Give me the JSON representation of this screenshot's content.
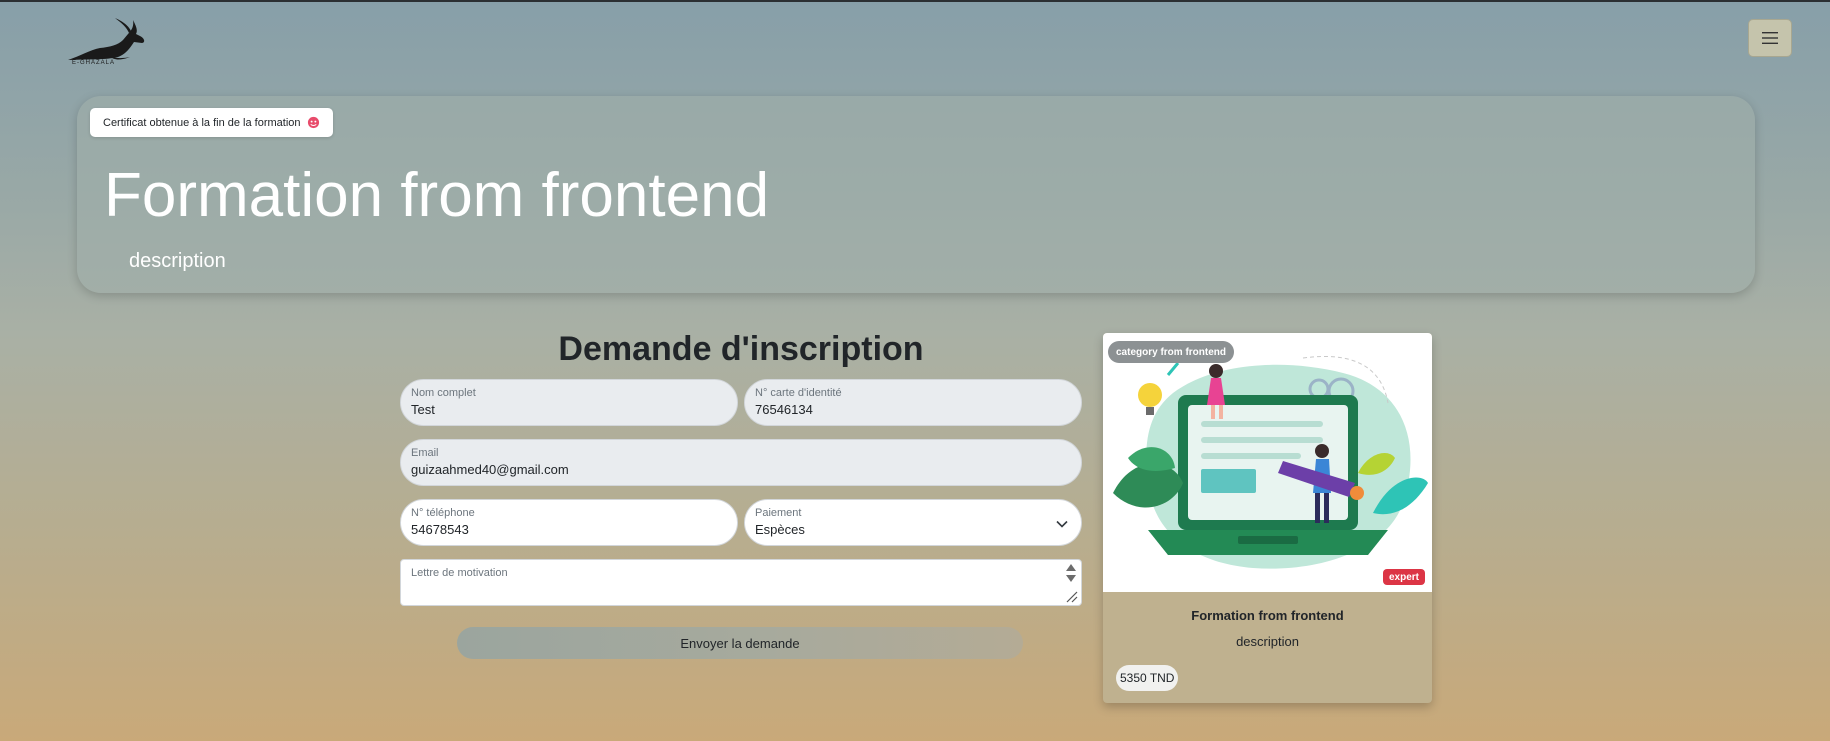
{
  "header": {
    "logo_text": "E-GHAZALA",
    "menu_icon": "hamburger-icon"
  },
  "hero": {
    "badge_label": "Certificat obtenue à la fin de la formation",
    "badge_icon": "smiling-face-with-hearts-icon",
    "title": "Formation from frontend",
    "description": "description"
  },
  "form": {
    "title": "Demande d'inscription",
    "fields": {
      "full_name": {
        "label": "Nom complet",
        "value": "Test"
      },
      "id_card": {
        "label": "N° carte d'identité",
        "value": "76546134"
      },
      "email": {
        "label": "Email",
        "value": "guizaahmed40@gmail.com"
      },
      "phone": {
        "label": "N° téléphone",
        "value": "54678543"
      },
      "payment": {
        "label": "Paiement",
        "value": "Espèces"
      },
      "motivation": {
        "label": "Lettre de motivation",
        "value": ""
      }
    },
    "submit_label": "Envoyer la demande"
  },
  "card": {
    "category": "category from frontend",
    "level": "expert",
    "title": "Formation from frontend",
    "description": "description",
    "price": "5350 TND"
  },
  "colors": {
    "accent_badge": "#dc3545",
    "field_bg": "#e9ecef",
    "card_bg": "#bfb18f"
  }
}
